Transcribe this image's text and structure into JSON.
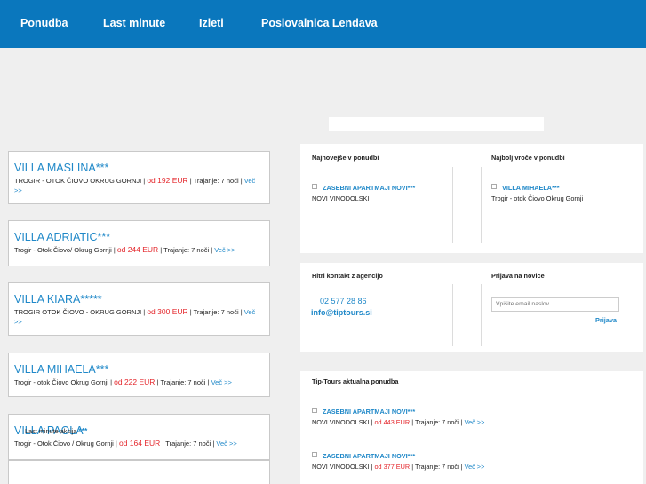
{
  "nav": [
    {
      "label": "Ponudba"
    },
    {
      "label": "Last minute"
    },
    {
      "label": "Izleti"
    },
    {
      "label": "Poslovalnica Lendava"
    }
  ],
  "listings": [
    {
      "title": "VILLA MASLINA***",
      "location": "TROGIR - OTOK ČIOVO OKRUG GORNJI",
      "price": "od 192 EUR",
      "duration": "Trajanje: 7 noči",
      "more": "Več >>"
    },
    {
      "title": "VILLA ADRIATIC***",
      "location": "Trogir - Otok Čiovo/ Okrug Gornji",
      "price": "od 244 EUR",
      "duration": "Trajanje: 7 noči",
      "more": "Več >>"
    },
    {
      "title": "VILLA KIARA*****",
      "location": "TROGIR OTOK ČIOVO - OKRUG GORNJI",
      "price": "od 300 EUR",
      "duration": "Trajanje: 7 noči",
      "more": "Več >>"
    },
    {
      "title": "VILLA MIHAELA***",
      "location": "Trogir - otok Čiovo Okrug Gornji",
      "price": "od 222 EUR",
      "duration": "Trajanje: 7 noči",
      "more": "Več >>"
    },
    {
      "title": "VILLA PAOLA",
      "location": "Trogir - Otok Čiovo / Okrug Gornji",
      "price": "od 164 EUR",
      "duration": "Trajanje: 7 noči",
      "more": "Več >>"
    }
  ],
  "overlay": {
    "label": "Last minute akcija",
    "stars": "***"
  },
  "najnovejse": {
    "heading": "Najnovejše v ponudbi",
    "link": "ZASEBNI APARTMAJI NOVI***",
    "sub": "NOVI VINODOLSKI"
  },
  "najbolj": {
    "heading": "Najbolj vroče v ponudbi",
    "link": "VILLA MIHAELA***",
    "sub": "Trogir - otok Čiovo Okrug Gornji"
  },
  "kontakt": {
    "heading": "Hitri kontakt z agencijo",
    "phone": "02 577 28 86",
    "email": "info@tiptours.si"
  },
  "novice": {
    "heading": "Prijava na novice",
    "placeholder": "Vpišite email naslov",
    "button": "Prijava"
  },
  "aktualna": {
    "heading": "Tip-Tours aktualna ponudba",
    "items": [
      {
        "link": "ZASEBNI APARTMAJI NOVI***",
        "location": "NOVI VINODOLSKI",
        "price": "od 443 EUR",
        "duration": "Trajanje: 7 noči",
        "more": "Več >>"
      },
      {
        "link": "ZASEBNI APARTMAJI NOVI***",
        "location": "NOVI VINODOLSKI",
        "price": "od 377 EUR",
        "duration": "Trajanje: 7 noči",
        "more": "Več >>"
      }
    ]
  },
  "colors": {
    "nav_bg": "#0a77bd",
    "link": "#1f88c8",
    "price": "#e4262b",
    "bg": "#efefef"
  }
}
